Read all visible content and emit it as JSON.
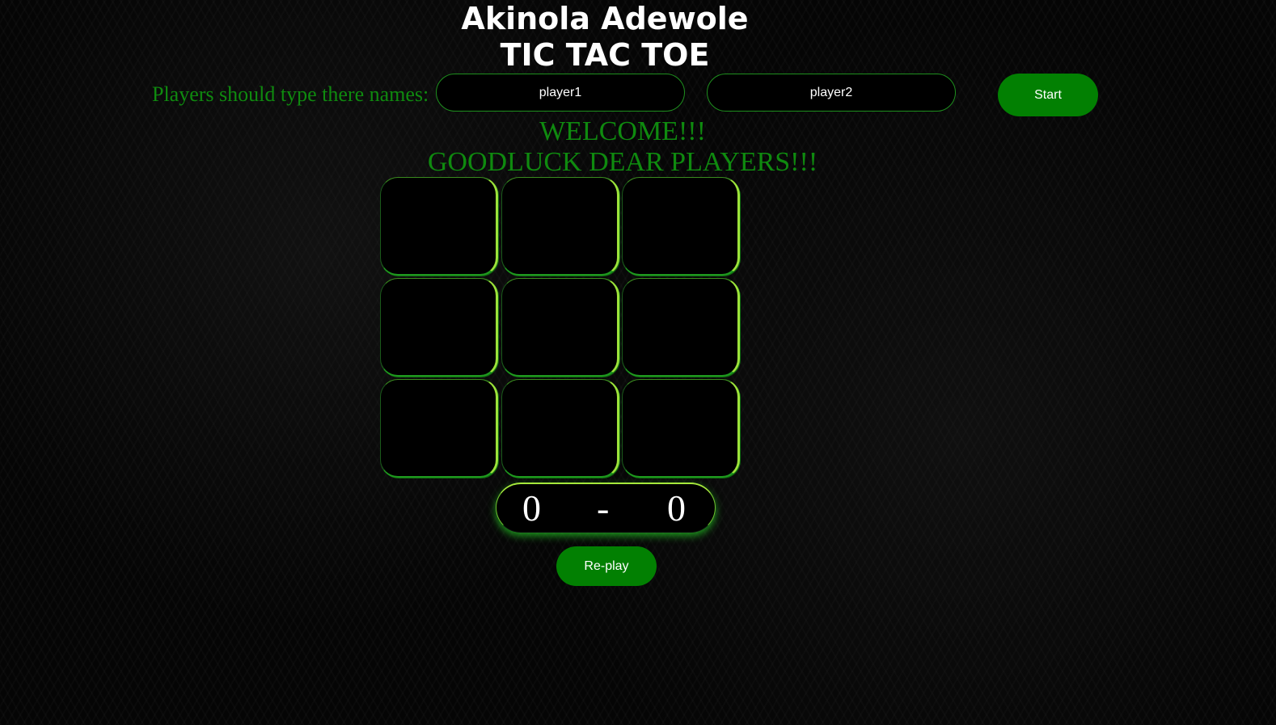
{
  "header": {
    "title_line1": "Akinola Adewole",
    "title_line2": "TIC TAC TOE"
  },
  "players": {
    "label": "Players should type there names:",
    "player1_placeholder": "player1",
    "player2_placeholder": "player2",
    "start_label": "Start"
  },
  "welcome": {
    "line1": "WELCOME!!!",
    "line2": "GOODLUCK DEAR PLAYERS!!!"
  },
  "board": {
    "cells": [
      "",
      "",
      "",
      "",
      "",
      "",
      "",
      "",
      ""
    ]
  },
  "score": {
    "player1": "0",
    "separator": "-",
    "player2": "0"
  },
  "replay_label": "Re-play",
  "colors": {
    "accent_green": "#028002",
    "text_green": "#0f8a0f",
    "glow_lime": "#9de23a"
  }
}
